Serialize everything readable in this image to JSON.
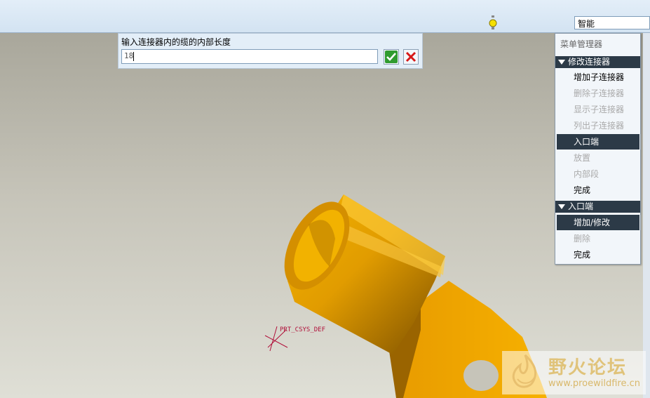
{
  "toolbar": {
    "filter_value": "智能",
    "status_icon": "traffic-light-icon"
  },
  "prompt": {
    "label": "输入连接器内的缆的内部长度",
    "value": "18",
    "ok_icon": "checkmark-icon",
    "cancel_icon": "close-x-icon"
  },
  "menu_manager": {
    "title": "菜单管理器",
    "section1": {
      "header": "修改连接器",
      "items": [
        "增加子连接器",
        "删除子连接器",
        "显示子连接器",
        "列出子连接器",
        "入口端",
        "放置",
        "内部段",
        "完成"
      ]
    },
    "section2": {
      "header": "入口端",
      "items": [
        "增加/修改",
        "删除",
        "完成"
      ]
    }
  },
  "model": {
    "csys_label": "PRT_CSYS_DEF"
  },
  "watermark": {
    "title": "野火论坛",
    "url": "www.proewildfire.cn"
  },
  "colors": {
    "part": "#e8a000",
    "menu_highlight": "#2c3a47",
    "toolbar": "#dbe8f4"
  }
}
